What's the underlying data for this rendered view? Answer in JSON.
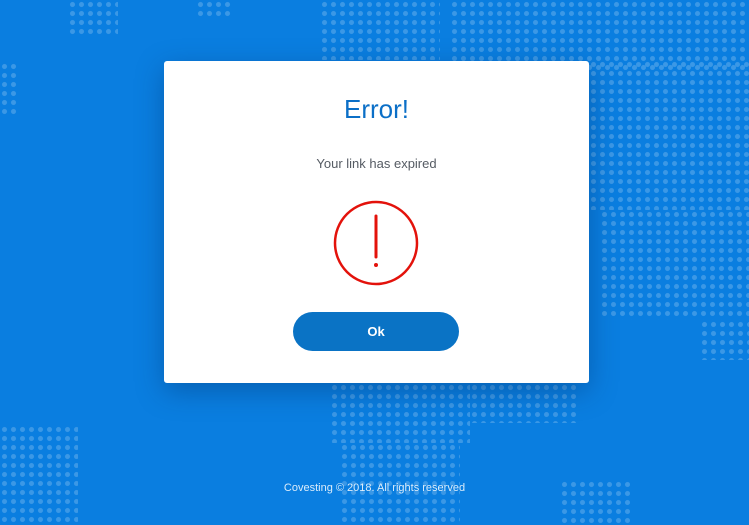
{
  "dialog": {
    "title": "Error!",
    "message": "Your link has expired",
    "icon": "exclamation-circle-icon",
    "icon_color": "#e3120b",
    "ok_label": "Ok"
  },
  "footer": {
    "text": "Covesting © 2018. All rights reserved"
  },
  "colors": {
    "background": "#0a7ee0",
    "accent": "#0b6fc7",
    "button": "#0a73c5"
  }
}
